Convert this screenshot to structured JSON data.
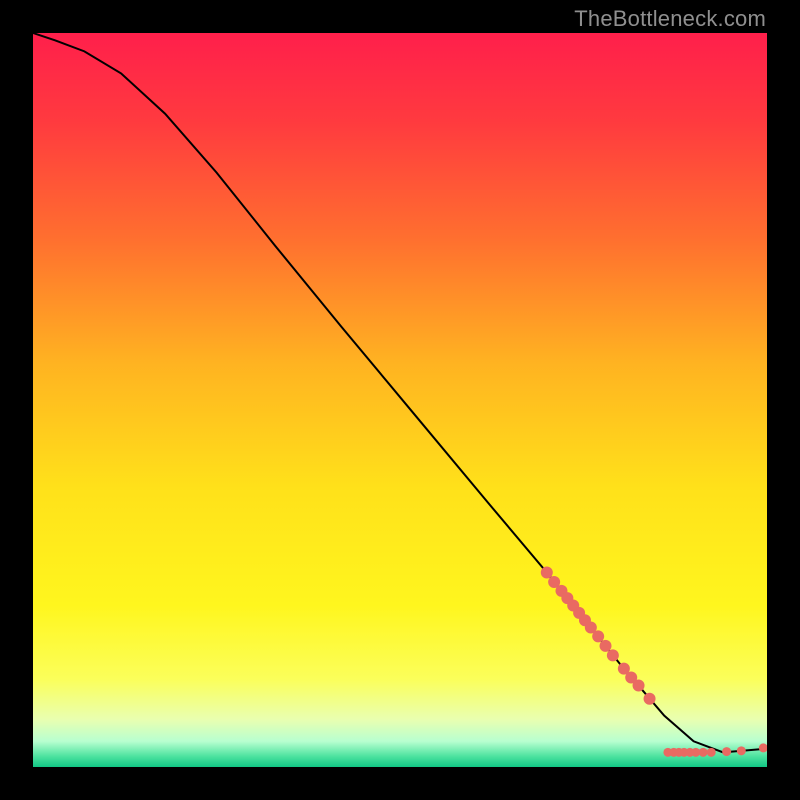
{
  "watermark": "TheBottleneck.com",
  "chart_data": {
    "type": "line",
    "title": "",
    "xlabel": "",
    "ylabel": "",
    "xlim": [
      0,
      100
    ],
    "ylim": [
      0,
      100
    ],
    "background_gradient": {
      "stops": [
        {
          "offset": 0.0,
          "color": "#ff1f4b"
        },
        {
          "offset": 0.12,
          "color": "#ff3a3f"
        },
        {
          "offset": 0.28,
          "color": "#ff6f2f"
        },
        {
          "offset": 0.45,
          "color": "#ffb321"
        },
        {
          "offset": 0.62,
          "color": "#ffe11a"
        },
        {
          "offset": 0.78,
          "color": "#fff61e"
        },
        {
          "offset": 0.88,
          "color": "#fbff5a"
        },
        {
          "offset": 0.935,
          "color": "#e9ffb0"
        },
        {
          "offset": 0.965,
          "color": "#b8ffd0"
        },
        {
          "offset": 0.985,
          "color": "#4fe3a0"
        },
        {
          "offset": 1.0,
          "color": "#12c785"
        }
      ]
    },
    "series": [
      {
        "name": "curve",
        "stroke": "#000000",
        "x": [
          0,
          3,
          7,
          12,
          18,
          25,
          33,
          42,
          52,
          62,
          70,
          76,
          80,
          83,
          86,
          90,
          94,
          100
        ],
        "y": [
          100,
          99,
          97.5,
          94.5,
          89,
          81,
          71,
          60,
          48,
          36,
          26.5,
          19,
          14,
          10.5,
          7,
          3.5,
          2,
          2.5
        ]
      }
    ],
    "highlight_points": {
      "color": "#e96a62",
      "radius_small": 4.5,
      "radius_large": 6,
      "points": [
        {
          "x": 70.0,
          "y": 26.5,
          "r": "l"
        },
        {
          "x": 71.0,
          "y": 25.2,
          "r": "l"
        },
        {
          "x": 72.0,
          "y": 24.0,
          "r": "l"
        },
        {
          "x": 72.8,
          "y": 23.0,
          "r": "l"
        },
        {
          "x": 73.6,
          "y": 22.0,
          "r": "l"
        },
        {
          "x": 74.4,
          "y": 21.0,
          "r": "l"
        },
        {
          "x": 75.2,
          "y": 20.0,
          "r": "l"
        },
        {
          "x": 76.0,
          "y": 19.0,
          "r": "l"
        },
        {
          "x": 77.0,
          "y": 17.8,
          "r": "l"
        },
        {
          "x": 78.0,
          "y": 16.5,
          "r": "l"
        },
        {
          "x": 79.0,
          "y": 15.2,
          "r": "l"
        },
        {
          "x": 80.5,
          "y": 13.4,
          "r": "l"
        },
        {
          "x": 81.5,
          "y": 12.2,
          "r": "l"
        },
        {
          "x": 82.5,
          "y": 11.1,
          "r": "l"
        },
        {
          "x": 84.0,
          "y": 9.3,
          "r": "l"
        },
        {
          "x": 86.5,
          "y": 2.0,
          "r": "s"
        },
        {
          "x": 87.3,
          "y": 2.0,
          "r": "s"
        },
        {
          "x": 88.0,
          "y": 2.0,
          "r": "s"
        },
        {
          "x": 88.7,
          "y": 2.0,
          "r": "s"
        },
        {
          "x": 89.5,
          "y": 2.0,
          "r": "s"
        },
        {
          "x": 90.3,
          "y": 2.0,
          "r": "s"
        },
        {
          "x": 91.3,
          "y": 2.0,
          "r": "s"
        },
        {
          "x": 92.4,
          "y": 2.0,
          "r": "s"
        },
        {
          "x": 94.5,
          "y": 2.1,
          "r": "s"
        },
        {
          "x": 96.5,
          "y": 2.2,
          "r": "s"
        },
        {
          "x": 99.5,
          "y": 2.6,
          "r": "s"
        }
      ]
    }
  }
}
